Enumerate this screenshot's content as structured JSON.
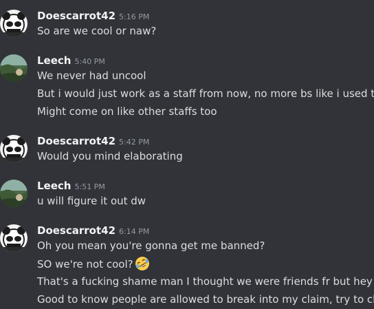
{
  "messages": [
    {
      "author": "Doescarrot42",
      "time": "5:16 PM",
      "lines": [
        "So are we cool or naw?"
      ]
    },
    {
      "author": "Leech",
      "time": "5:40 PM",
      "lines": [
        "We never had uncool",
        "But i would just work as a staff from now, no more bs like i used to",
        "Might come on like other staffs too"
      ]
    },
    {
      "author": "Doescarrot42",
      "time": "5:42 PM",
      "lines": [
        "Would you mind elaborating"
      ]
    },
    {
      "author": "Leech",
      "time": "5:51 PM",
      "lines": [
        "u will figure it out dw"
      ]
    },
    {
      "author": "Doescarrot42",
      "time": "6:14 PM",
      "lines": [
        "Oh you mean you're gonna get me banned?",
        "SO we're not cool?",
        "That's a fucking shame man I thought we were friends fr but hey that's th",
        "Good to know people are allowed to break into my claim, try to claim kill"
      ]
    }
  ],
  "emoji": {
    "icon": "rolling-on-floor-laughing-icon"
  },
  "colors": {
    "background": "#313338",
    "username": "#f2f3f5",
    "text": "#dbdee1",
    "timestamp": "#949ba4"
  }
}
